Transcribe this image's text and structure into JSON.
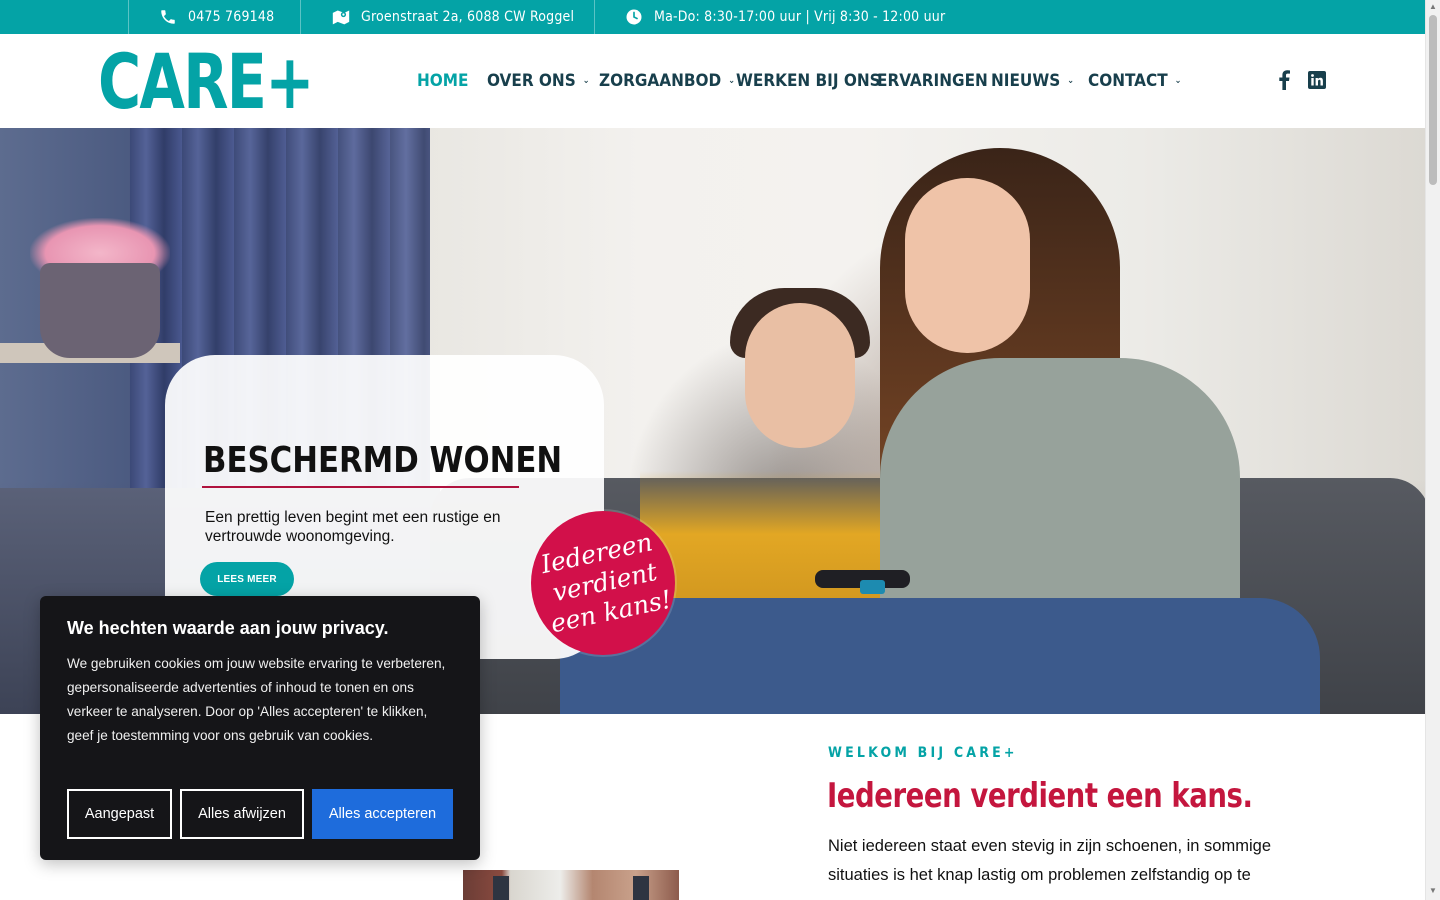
{
  "topbar": {
    "phone": "0475 769148",
    "address": "Groenstraat 2a, 6088 CW Roggel",
    "hours": "Ma-Do: 8:30-17:00 uur | Vrij 8:30 - 12:00 uur",
    "icons": [
      "phone-icon",
      "map-icon",
      "clock-icon"
    ]
  },
  "header": {
    "logo": "CARE+",
    "nav": [
      {
        "label": "HOME",
        "dropdown": false,
        "active": true
      },
      {
        "label": "OVER ONS",
        "dropdown": true,
        "active": false
      },
      {
        "label": "ZORGAANBOD",
        "dropdown": true,
        "active": false
      },
      {
        "label": "WERKEN BIJ ONS",
        "dropdown": false,
        "active": false
      },
      {
        "label": "ERVARINGEN",
        "dropdown": false,
        "active": false
      },
      {
        "label": "NIEUWS",
        "dropdown": true,
        "active": false
      },
      {
        "label": "CONTACT",
        "dropdown": true,
        "active": false
      }
    ],
    "social": [
      "facebook-icon",
      "linkedin-icon"
    ]
  },
  "hero": {
    "title": "BESCHERMD WONEN",
    "text": "Een prettig leven begint met een rustige en vertrouwde woonomgeving.",
    "button": "LEES MEER",
    "badge_lines": [
      "Iedereen",
      "verdient",
      "een kans!"
    ]
  },
  "welcome": {
    "label": "WELKOM BIJ CARE+",
    "title": "Iedereen verdient een kans.",
    "text": "Niet iedereen staat even stevig in zijn schoenen, in sommige situaties is het knap lastig om problemen zelfstandig op te"
  },
  "cookie": {
    "title": "We hechten waarde aan jouw privacy.",
    "text": "We gebruiken cookies om jouw website ervaring te verbeteren, gepersonaliseerde advertenties of inhoud te tonen en ons verkeer te analyseren. Door op 'Alles accepteren' te klikken, geef je toestemming voor ons gebruik van cookies.",
    "buttons": {
      "custom": "Aangepast",
      "reject": "Alles afwijzen",
      "accept": "Alles accepteren"
    }
  },
  "colors": {
    "brand_teal": "#04a3a6",
    "accent_red": "#c4163e",
    "nav_dark": "#183f4c",
    "accept_blue": "#1e6cdc"
  }
}
